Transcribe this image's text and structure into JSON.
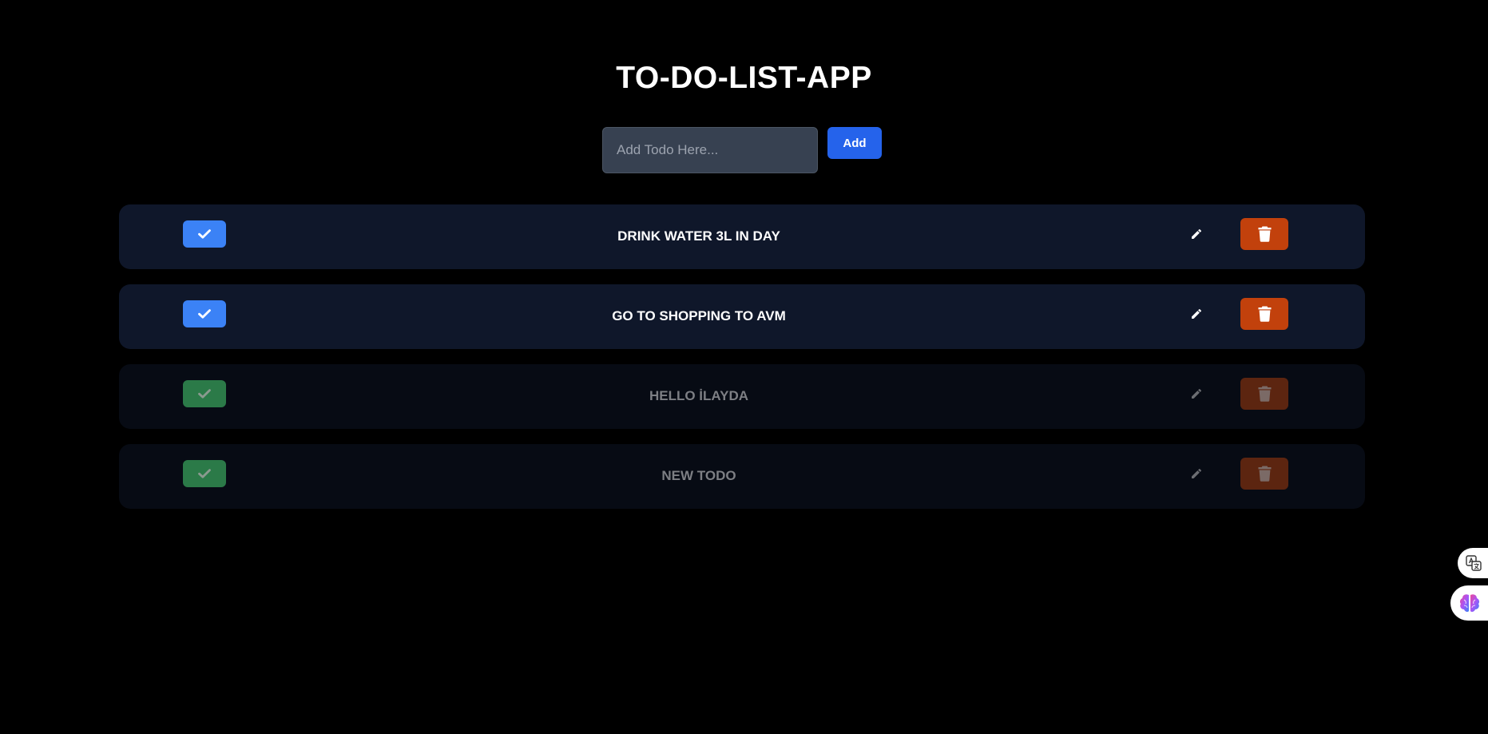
{
  "app": {
    "title": "TO-DO-LIST-APP"
  },
  "add_form": {
    "input_value": "",
    "placeholder": "Add Todo Here...",
    "add_label": "Add"
  },
  "colors": {
    "background": "#000000",
    "row_active": "#0f172a",
    "row_done": "#070b14",
    "check_active": "#3b82f6",
    "check_done": "#2b7a48",
    "delete_active": "#c2410c",
    "delete_done": "#5c2510",
    "add_button": "#2563eb"
  },
  "todos": [
    {
      "text": "DRINK WATER 3L IN DAY",
      "completed": false,
      "check_icon": "check-icon",
      "edit_icon": "pencil-icon",
      "delete_icon": "trash-icon"
    },
    {
      "text": "GO TO SHOPPING TO AVM",
      "completed": false,
      "check_icon": "check-icon",
      "edit_icon": "pencil-icon",
      "delete_icon": "trash-icon"
    },
    {
      "text": "HELLO İLAYDA",
      "completed": true,
      "check_icon": "check-icon",
      "edit_icon": "pencil-icon",
      "delete_icon": "trash-icon"
    },
    {
      "text": "NEW TODO",
      "completed": true,
      "check_icon": "check-icon",
      "edit_icon": "pencil-icon",
      "delete_icon": "trash-icon"
    }
  ],
  "side_widgets": [
    {
      "icon": "translate-icon"
    },
    {
      "icon": "brain-icon"
    }
  ]
}
